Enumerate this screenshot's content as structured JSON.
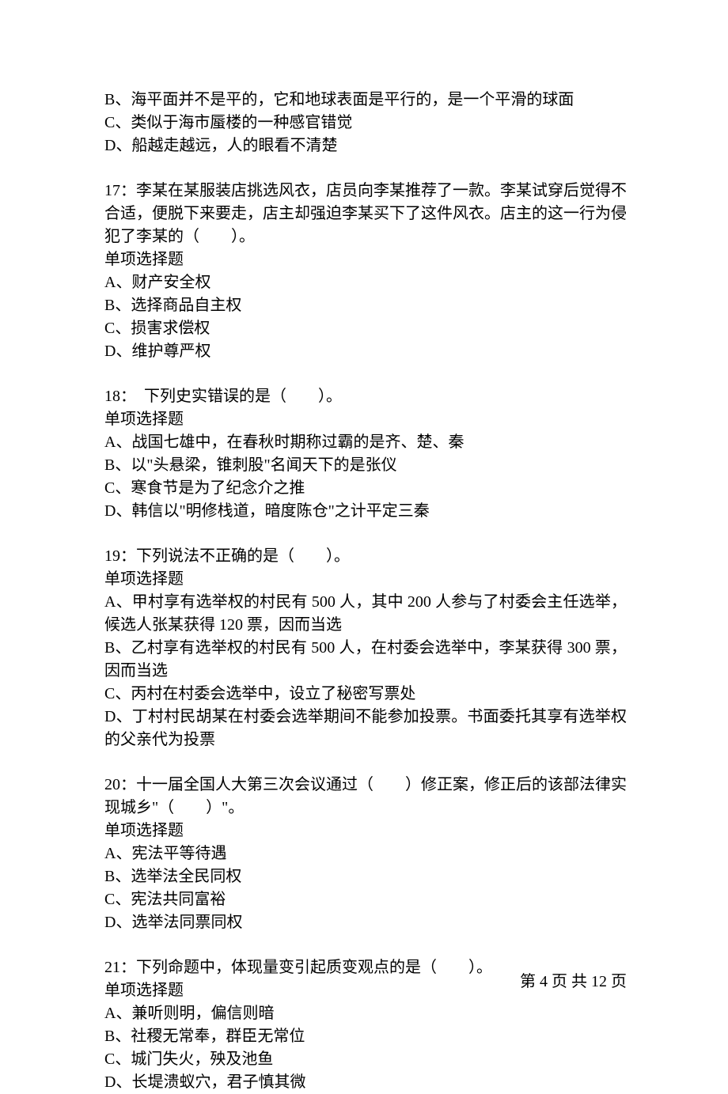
{
  "partial_options_top": {
    "B": "B、海平面并不是平的，它和地球表面是平行的，是一个平滑的球面",
    "C": "C、类似于海市蜃楼的一种感官错觉",
    "D": "D、船越走越远，人的眼看不清楚"
  },
  "questions": [
    {
      "num": "17",
      "stem": "17：李某在某服装店挑选风衣，店员向李某推荐了一款。李某试穿后觉得不合适，便脱下来要走，店主却强迫李某买下了这件风衣。店主的这一行为侵犯了李某的（　　）。",
      "type": "单项选择题",
      "options": {
        "A": "A、财产安全权",
        "B": "B、选择商品自主权",
        "C": "C、损害求偿权",
        "D": "D、维护尊严权"
      }
    },
    {
      "num": "18",
      "stem": "18：　下列史实错误的是（　　）。",
      "type": "单项选择题",
      "options": {
        "A": "A、战国七雄中，在春秋时期称过霸的是齐、楚、秦",
        "B": "B、以\"头悬梁，锥刺股\"名闻天下的是张仪",
        "C": "C、寒食节是为了纪念介之推",
        "D": "D、韩信以\"明修栈道，暗度陈仓\"之计平定三秦"
      }
    },
    {
      "num": "19",
      "stem": "19：下列说法不正确的是（　　）。",
      "type": "单项选择题",
      "options": {
        "A": "A、甲村享有选举权的村民有 500 人，其中 200 人参与了村委会主任选举，候选人张某获得 120 票，因而当选",
        "B": "B、乙村享有选举权的村民有 500 人，在村委会选举中，李某获得 300 票，因而当选",
        "C": "C、丙村在村委会选举中，设立了秘密写票处",
        "D": "D、丁村村民胡某在村委会选举期间不能参加投票。书面委托其享有选举权的父亲代为投票"
      }
    },
    {
      "num": "20",
      "stem": "20：十一届全国人大第三次会议通过（　　）修正案，修正后的该部法律实现城乡\"（　　）\"。",
      "type": "单项选择题",
      "options": {
        "A": "A、宪法平等待遇",
        "B": "B、选举法全民同权",
        "C": "C、宪法共同富裕",
        "D": "D、选举法同票同权"
      }
    },
    {
      "num": "21",
      "stem": "21：下列命题中，体现量变引起质变观点的是（　　）。",
      "type": "单项选择题",
      "options": {
        "A": "A、兼听则明，偏信则暗",
        "B": "B、社稷无常奉，群臣无常位",
        "C": "C、城门失火，殃及池鱼",
        "D": "D、长堤溃蚁穴，君子慎其微"
      }
    }
  ],
  "footer": {
    "text": "第 4 页 共 12 页",
    "current": 4,
    "total": 12
  }
}
